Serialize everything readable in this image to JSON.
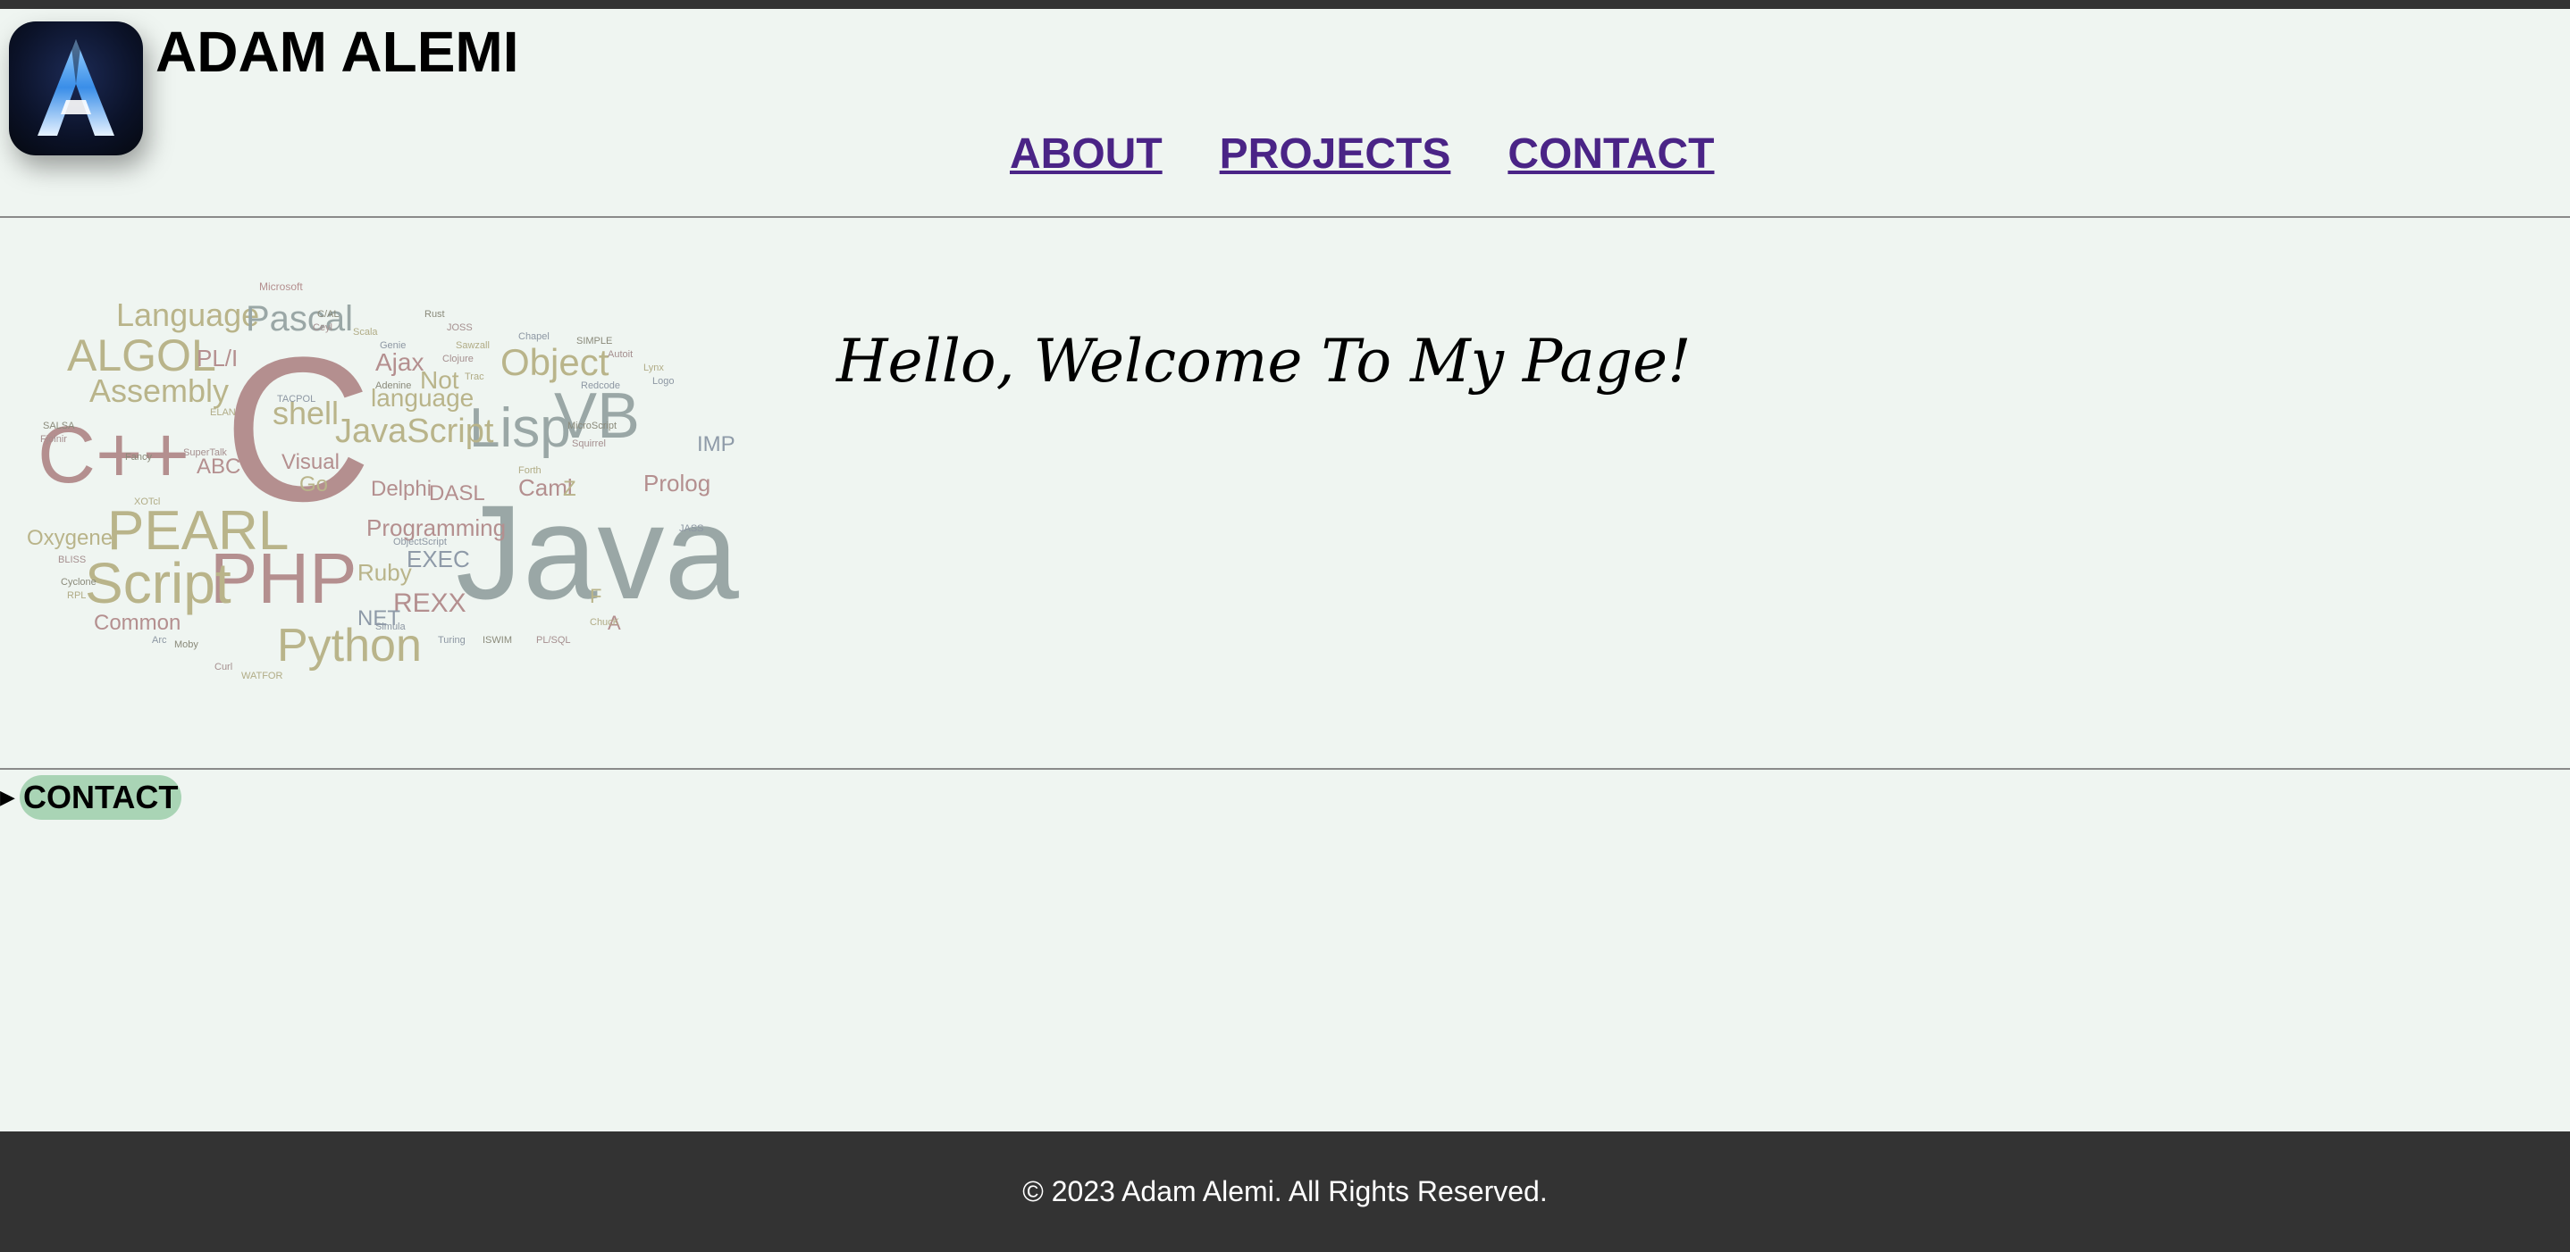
{
  "header": {
    "logo_letter": "A",
    "site_title": "ADAM ALEMI",
    "nav": [
      {
        "label": "ABOUT"
      },
      {
        "label": "PROJECTS"
      },
      {
        "label": "CONTACT"
      }
    ]
  },
  "main": {
    "welcome_text": "Hello, Welcome To My Page!",
    "wordcloud_words": [
      "Java",
      "C",
      "PHP",
      "Script",
      "Python",
      "Lisp",
      "VB",
      "C++",
      "PEARL",
      "Object",
      "JavaScript",
      "ALGOL",
      "Assembly",
      "Language",
      "Pascal",
      "shell",
      "Programming",
      "REXX",
      "Common",
      "Oxygene",
      "Prolog",
      "Ruby",
      "EXEC",
      "Delphi",
      "DASL",
      "Caml",
      "IMP",
      "language",
      "Ajax",
      "Not",
      "PL/I",
      "ABC",
      "Visual",
      "Go",
      "NET",
      "Z",
      "F",
      "A",
      "Microsoft"
    ]
  },
  "contact_section": {
    "summary_label": "CONTACT"
  },
  "footer": {
    "copyright": "© 2023 Adam Alemi. All Rights Reserved."
  },
  "colors": {
    "background": "#eff5f1",
    "topbar": "#333333",
    "nav_link": "#4a2486",
    "contact_pill": "#a9d4b5",
    "footer_bg": "#333333",
    "footer_text": "#ffffff"
  }
}
